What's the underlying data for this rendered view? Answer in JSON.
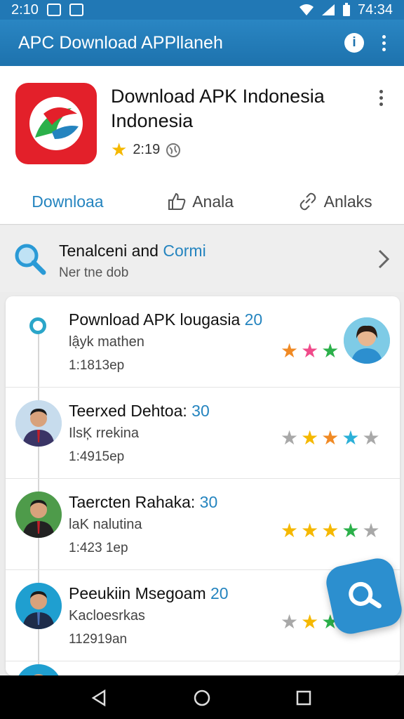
{
  "status_bar": {
    "time": "2:10",
    "clock": "74:34"
  },
  "app_bar": {
    "title": "APC Download APPllaneh"
  },
  "app_header": {
    "title": "Download APK Indonesia Indonesia",
    "rating": "2:19"
  },
  "actions": [
    {
      "label": "Downloaa",
      "icon": ""
    },
    {
      "label": "Anala",
      "icon": "thumbs-up-icon"
    },
    {
      "label": "Anlaks",
      "icon": "link-icon"
    }
  ],
  "promo": {
    "title_main": "Tenalceni and",
    "title_accent": "Cormi",
    "subtitle": "Ner tne dob"
  },
  "list_items": [
    {
      "name": "Pownload APK lougasia",
      "num": "20",
      "sub": "lậyk mathen",
      "meta": "1:1813ep",
      "stars": [
        "#f08a24",
        "#f04a8a",
        "#2bb04a"
      ]
    },
    {
      "name": "Teerxed Dehtoa:",
      "num": "30",
      "sub": "IlsĶ rrekina",
      "meta": "1:4915ep",
      "stars": [
        "#a8a8a8",
        "#f5b800",
        "#f08a24",
        "#2bb0d8",
        "#a8a8a8"
      ]
    },
    {
      "name": "Taercten Rahaka:",
      "num": "30",
      "sub": "laK nalutina",
      "meta": "1:423 1ep",
      "stars": [
        "#f5b800",
        "#f5b800",
        "#f5b800",
        "#2bb04a",
        "#a8a8a8"
      ]
    },
    {
      "name": "Peeukiin Msegoam",
      "num": "20",
      "sub": "Kacloesrkas",
      "meta": "112919an",
      "stars": [
        "#a8a8a8",
        "#f5b800",
        "#2bb04a"
      ]
    }
  ],
  "colors": {
    "accent": "#2484bf",
    "app_bar": "#1d72ad",
    "logo": "#e3202a"
  }
}
